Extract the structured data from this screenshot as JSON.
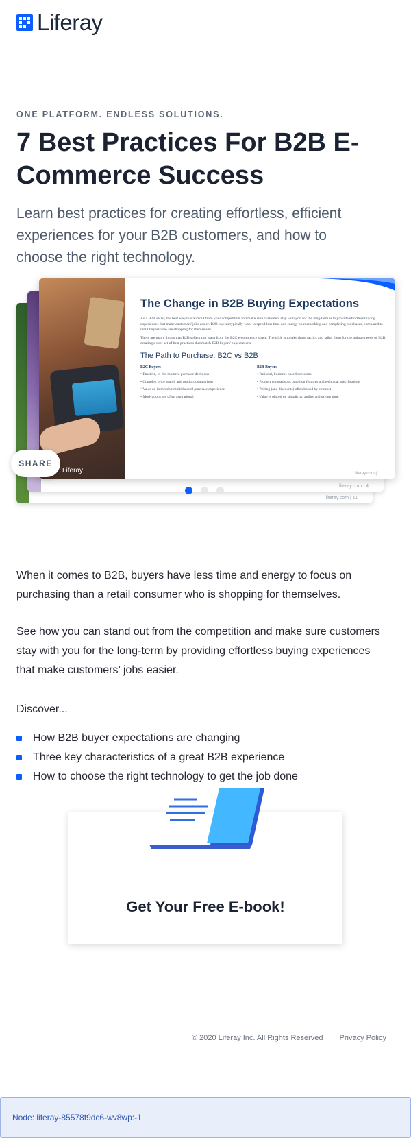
{
  "brand": {
    "logo_text": "Liferay",
    "accent_color": "#0b5fff"
  },
  "hero": {
    "eyebrow": "ONE PLATFORM. ENDLESS SOLUTIONS.",
    "title": "7 Best Practices For B2B E-Commerce Success",
    "subtitle": "Learn best practices for creating effortless, efficient experiences for your B2B customers, and how to choose the right technology."
  },
  "carousel": {
    "share_label": "SHARE",
    "dots": 3,
    "active_dot": 0,
    "front_slide": {
      "photo_logo": "Liferay",
      "title": "The Change in B2B Buying Expectations",
      "para1": "As a B2B seller, the best way to stand out from your competition and make sure customers stay with you for the long-term is to provide effortless buying experiences that make customers' jobs easier. B2B buyers typically want to spend less time and energy on researching and completing purchases, compared to retail buyers who are shopping for themselves.",
      "para2": "There are many things that B2B sellers can learn from the B2C e-commerce space. The trick is to take those tactics and tailor them for the unique needs of B2B, creating a new set of best practices that match B2B buyers' expectations.",
      "subtitle": "The Path to Purchase: B2C vs B2B",
      "col_b2c_head": "B2C Buyers",
      "col_b2b_head": "B2B Buyers",
      "b2c": [
        "Emotive, in-the-moment purchase decisions",
        "Complex price search and product comparison",
        "Value an immersive multichannel purchase experience",
        "Motivations are often aspirational"
      ],
      "b2b": [
        "Rational, business-based decisions",
        "Product comparisons based on features and technical specifications",
        "Pricing (and discounts) often bound by contract",
        "Value is placed on simplicity, agility and saving time"
      ],
      "page_num": "liferay.com | 1"
    },
    "back1_page_num": "liferay.com | 4",
    "back2_page_num": "liferay.com | 11"
  },
  "body": {
    "p1": "When it comes to B2B, buyers have less time and energy to focus on purchasing than a retail consumer who is shopping for themselves.",
    "p2": "See how you can stand out from the competition and make sure customers stay with you for the long-term by providing effortless buying experiences that make customers’ jobs easier.",
    "p3": "Discover...",
    "bullets": [
      "How B2B buyer expectations are changing",
      "Three key characteristics of a great B2B experience",
      "How to choose the right technology to get the job done"
    ]
  },
  "cta": {
    "label": "Get Your Free E-book!"
  },
  "footer": {
    "copyright": "© 2020 Liferay Inc. All Rights Reserved",
    "privacy": "Privacy Policy",
    "node": "Node: liferay-85578f9dc6-wv8wp:-1"
  }
}
